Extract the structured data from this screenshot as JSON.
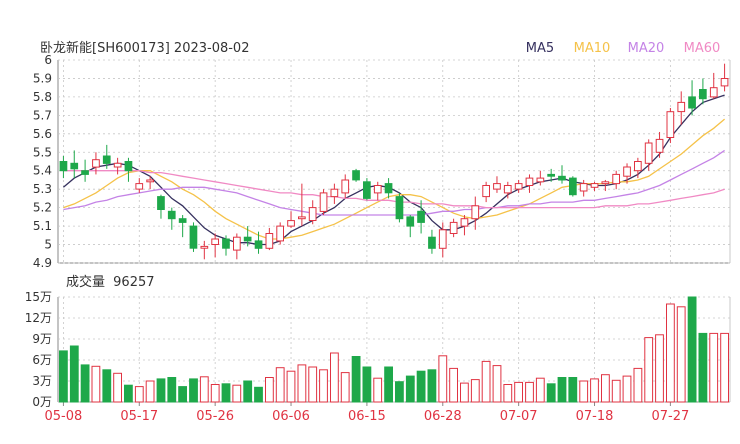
{
  "header": {
    "title": "卧龙新能[SH600173] 2023-08-02",
    "volume_label": "成交量",
    "volume_value": "96257"
  },
  "legend": [
    {
      "name": "MA5",
      "color": "#36315f"
    },
    {
      "name": "MA10",
      "color": "#f5c249"
    },
    {
      "name": "MA20",
      "color": "#c483e6"
    },
    {
      "name": "MA60",
      "color": "#f08ac4"
    }
  ],
  "colors": {
    "up": "#e03342",
    "down": "#1ea84a",
    "grid": "#c8c8c8",
    "axis_text": "#333333",
    "date_text": "#e03342"
  },
  "chart_data": [
    {
      "type": "candlestick",
      "ylim": [
        4.9,
        6.0
      ],
      "y_ticks": [
        "4.9",
        "5",
        "5.1",
        "5.2",
        "5.3",
        "5.4",
        "5.5",
        "5.6",
        "5.7",
        "5.8",
        "5.9",
        "6"
      ],
      "x_tick_labels": [
        {
          "index": 0,
          "label": "05-08"
        },
        {
          "index": 7,
          "label": "05-17"
        },
        {
          "index": 14,
          "label": "05-26"
        },
        {
          "index": 21,
          "label": "06-06"
        },
        {
          "index": 28,
          "label": "06-15"
        },
        {
          "index": 35,
          "label": "06-28"
        },
        {
          "index": 42,
          "label": "07-07"
        },
        {
          "index": 49,
          "label": "07-18"
        },
        {
          "index": 56,
          "label": "07-27"
        }
      ],
      "candles": [
        [
          5.45,
          5.4,
          5.48,
          5.36
        ],
        [
          5.44,
          5.41,
          5.51,
          5.36
        ],
        [
          5.4,
          5.38,
          5.46,
          5.34
        ],
        [
          5.42,
          5.46,
          5.5,
          5.38
        ],
        [
          5.48,
          5.44,
          5.54,
          5.41
        ],
        [
          5.42,
          5.44,
          5.47,
          5.38
        ],
        [
          5.45,
          5.4,
          5.47,
          5.34
        ],
        [
          5.3,
          5.33,
          5.36,
          5.28
        ],
        [
          5.34,
          5.35,
          5.37,
          5.3
        ],
        [
          5.26,
          5.19,
          5.27,
          5.14
        ],
        [
          5.18,
          5.14,
          5.2,
          5.08
        ],
        [
          5.14,
          5.12,
          5.16,
          5.04
        ],
        [
          5.1,
          4.98,
          5.12,
          4.96
        ],
        [
          4.98,
          4.99,
          5.02,
          4.92
        ],
        [
          5.0,
          5.03,
          5.06,
          4.93
        ],
        [
          5.03,
          4.98,
          5.05,
          4.94
        ],
        [
          4.97,
          5.04,
          5.06,
          4.92
        ],
        [
          5.04,
          5.02,
          5.1,
          4.99
        ],
        [
          5.02,
          4.98,
          5.07,
          4.95
        ],
        [
          4.98,
          5.06,
          5.09,
          4.97
        ],
        [
          5.02,
          5.1,
          5.12,
          5.0
        ],
        [
          5.1,
          5.13,
          5.18,
          5.09
        ],
        [
          5.14,
          5.15,
          5.33,
          5.1
        ],
        [
          5.13,
          5.2,
          5.24,
          5.11
        ],
        [
          5.18,
          5.28,
          5.3,
          5.16
        ],
        [
          5.26,
          5.3,
          5.33,
          5.22
        ],
        [
          5.28,
          5.35,
          5.38,
          5.25
        ],
        [
          5.4,
          5.35,
          5.41,
          5.34
        ],
        [
          5.34,
          5.25,
          5.36,
          5.24
        ],
        [
          5.28,
          5.32,
          5.34,
          5.24
        ],
        [
          5.33,
          5.28,
          5.36,
          5.25
        ],
        [
          5.26,
          5.14,
          5.28,
          5.12
        ],
        [
          5.15,
          5.1,
          5.16,
          5.04
        ],
        [
          5.18,
          5.12,
          5.24,
          5.06
        ],
        [
          5.04,
          4.98,
          5.08,
          4.95
        ],
        [
          4.98,
          5.08,
          5.12,
          4.93
        ],
        [
          5.06,
          5.12,
          5.14,
          5.04
        ],
        [
          5.1,
          5.14,
          5.16,
          5.05
        ],
        [
          5.14,
          5.21,
          5.26,
          5.08
        ],
        [
          5.26,
          5.32,
          5.34,
          5.23
        ],
        [
          5.3,
          5.33,
          5.37,
          5.28
        ],
        [
          5.28,
          5.32,
          5.34,
          5.25
        ],
        [
          5.3,
          5.33,
          5.35,
          5.28
        ],
        [
          5.32,
          5.36,
          5.38,
          5.28
        ],
        [
          5.34,
          5.36,
          5.4,
          5.32
        ],
        [
          5.38,
          5.37,
          5.41,
          5.34
        ],
        [
          5.37,
          5.35,
          5.43,
          5.33
        ],
        [
          5.36,
          5.27,
          5.37,
          5.26
        ],
        [
          5.29,
          5.33,
          5.35,
          5.26
        ],
        [
          5.31,
          5.33,
          5.34,
          5.29
        ],
        [
          5.33,
          5.34,
          5.35,
          5.29
        ],
        [
          5.33,
          5.38,
          5.4,
          5.3
        ],
        [
          5.37,
          5.42,
          5.44,
          5.33
        ],
        [
          5.4,
          5.45,
          5.47,
          5.36
        ],
        [
          5.44,
          5.55,
          5.57,
          5.4
        ],
        [
          5.5,
          5.57,
          5.61,
          5.47
        ],
        [
          5.58,
          5.72,
          5.74,
          5.55
        ],
        [
          5.72,
          5.77,
          5.83,
          5.65
        ],
        [
          5.8,
          5.74,
          5.89,
          5.7
        ],
        [
          5.84,
          5.79,
          5.9,
          5.76
        ],
        [
          5.8,
          5.85,
          5.93,
          5.79
        ],
        [
          5.86,
          5.9,
          5.98,
          5.83
        ]
      ],
      "ma5": [
        5.31,
        5.36,
        5.39,
        5.42,
        5.43,
        5.44,
        5.43,
        5.4,
        5.37,
        5.31,
        5.25,
        5.21,
        5.15,
        5.09,
        5.05,
        5.03,
        5.01,
        5.01,
        5.0,
        5.0,
        5.02,
        5.07,
        5.1,
        5.13,
        5.17,
        5.2,
        5.25,
        5.28,
        5.31,
        5.32,
        5.31,
        5.28,
        5.23,
        5.2,
        5.13,
        5.08,
        5.08,
        5.1,
        5.13,
        5.17,
        5.22,
        5.27,
        5.3,
        5.32,
        5.34,
        5.35,
        5.36,
        5.34,
        5.33,
        5.32,
        5.32,
        5.33,
        5.35,
        5.38,
        5.43,
        5.49,
        5.58,
        5.65,
        5.72,
        5.77,
        5.79,
        5.81
      ],
      "ma10": [
        5.2,
        5.22,
        5.25,
        5.28,
        5.32,
        5.36,
        5.39,
        5.4,
        5.4,
        5.37,
        5.34,
        5.3,
        5.27,
        5.23,
        5.18,
        5.14,
        5.11,
        5.08,
        5.05,
        5.03,
        5.03,
        5.04,
        5.05,
        5.07,
        5.09,
        5.11,
        5.14,
        5.17,
        5.2,
        5.23,
        5.26,
        5.27,
        5.27,
        5.26,
        5.23,
        5.2,
        5.17,
        5.15,
        5.14,
        5.15,
        5.16,
        5.18,
        5.2,
        5.22,
        5.25,
        5.28,
        5.31,
        5.32,
        5.33,
        5.33,
        5.33,
        5.34,
        5.34,
        5.35,
        5.37,
        5.41,
        5.45,
        5.49,
        5.54,
        5.59,
        5.63,
        5.68
      ],
      "ma20": [
        5.19,
        5.2,
        5.21,
        5.23,
        5.24,
        5.26,
        5.27,
        5.28,
        5.29,
        5.3,
        5.3,
        5.31,
        5.31,
        5.31,
        5.3,
        5.29,
        5.28,
        5.26,
        5.24,
        5.22,
        5.2,
        5.19,
        5.18,
        5.17,
        5.16,
        5.16,
        5.16,
        5.16,
        5.16,
        5.16,
        5.16,
        5.16,
        5.16,
        5.16,
        5.17,
        5.18,
        5.18,
        5.19,
        5.19,
        5.2,
        5.2,
        5.21,
        5.21,
        5.22,
        5.22,
        5.23,
        5.23,
        5.23,
        5.24,
        5.24,
        5.25,
        5.26,
        5.27,
        5.28,
        5.3,
        5.32,
        5.35,
        5.38,
        5.41,
        5.44,
        5.47,
        5.51
      ],
      "ma60": [
        5.4,
        5.4,
        5.4,
        5.4,
        5.4,
        5.4,
        5.4,
        5.4,
        5.39,
        5.39,
        5.38,
        5.37,
        5.36,
        5.35,
        5.34,
        5.33,
        5.32,
        5.31,
        5.3,
        5.29,
        5.28,
        5.28,
        5.27,
        5.27,
        5.26,
        5.26,
        5.25,
        5.25,
        5.24,
        5.24,
        5.24,
        5.23,
        5.23,
        5.22,
        5.22,
        5.22,
        5.21,
        5.21,
        5.21,
        5.2,
        5.2,
        5.2,
        5.2,
        5.2,
        5.2,
        5.2,
        5.2,
        5.2,
        5.2,
        5.2,
        5.21,
        5.21,
        5.21,
        5.22,
        5.22,
        5.23,
        5.24,
        5.25,
        5.26,
        5.27,
        5.28,
        5.3
      ]
    },
    {
      "type": "bar",
      "unit": "万",
      "ylim": [
        0,
        15
      ],
      "y_ticks": [
        "0万",
        "3万",
        "6万",
        "9万",
        "12万",
        "15万"
      ],
      "values": [
        7.3,
        8.0,
        5.3,
        5.1,
        4.6,
        4.1,
        2.4,
        2.2,
        3.0,
        3.3,
        3.5,
        2.2,
        3.3,
        3.6,
        2.5,
        2.6,
        2.4,
        3.0,
        2.1,
        3.5,
        4.9,
        4.4,
        5.3,
        5.0,
        4.6,
        7.0,
        4.2,
        6.5,
        5.0,
        3.4,
        5.0,
        2.9,
        3.7,
        4.4,
        4.6,
        6.6,
        4.8,
        2.7,
        3.2,
        5.8,
        5.2,
        2.5,
        2.8,
        2.8,
        3.4,
        2.6,
        3.5,
        3.5,
        3.0,
        3.3,
        3.9,
        3.1,
        3.7,
        4.8,
        9.2,
        9.6,
        14.0,
        13.6,
        15.0,
        9.8,
        9.8,
        9.8
      ]
    }
  ]
}
